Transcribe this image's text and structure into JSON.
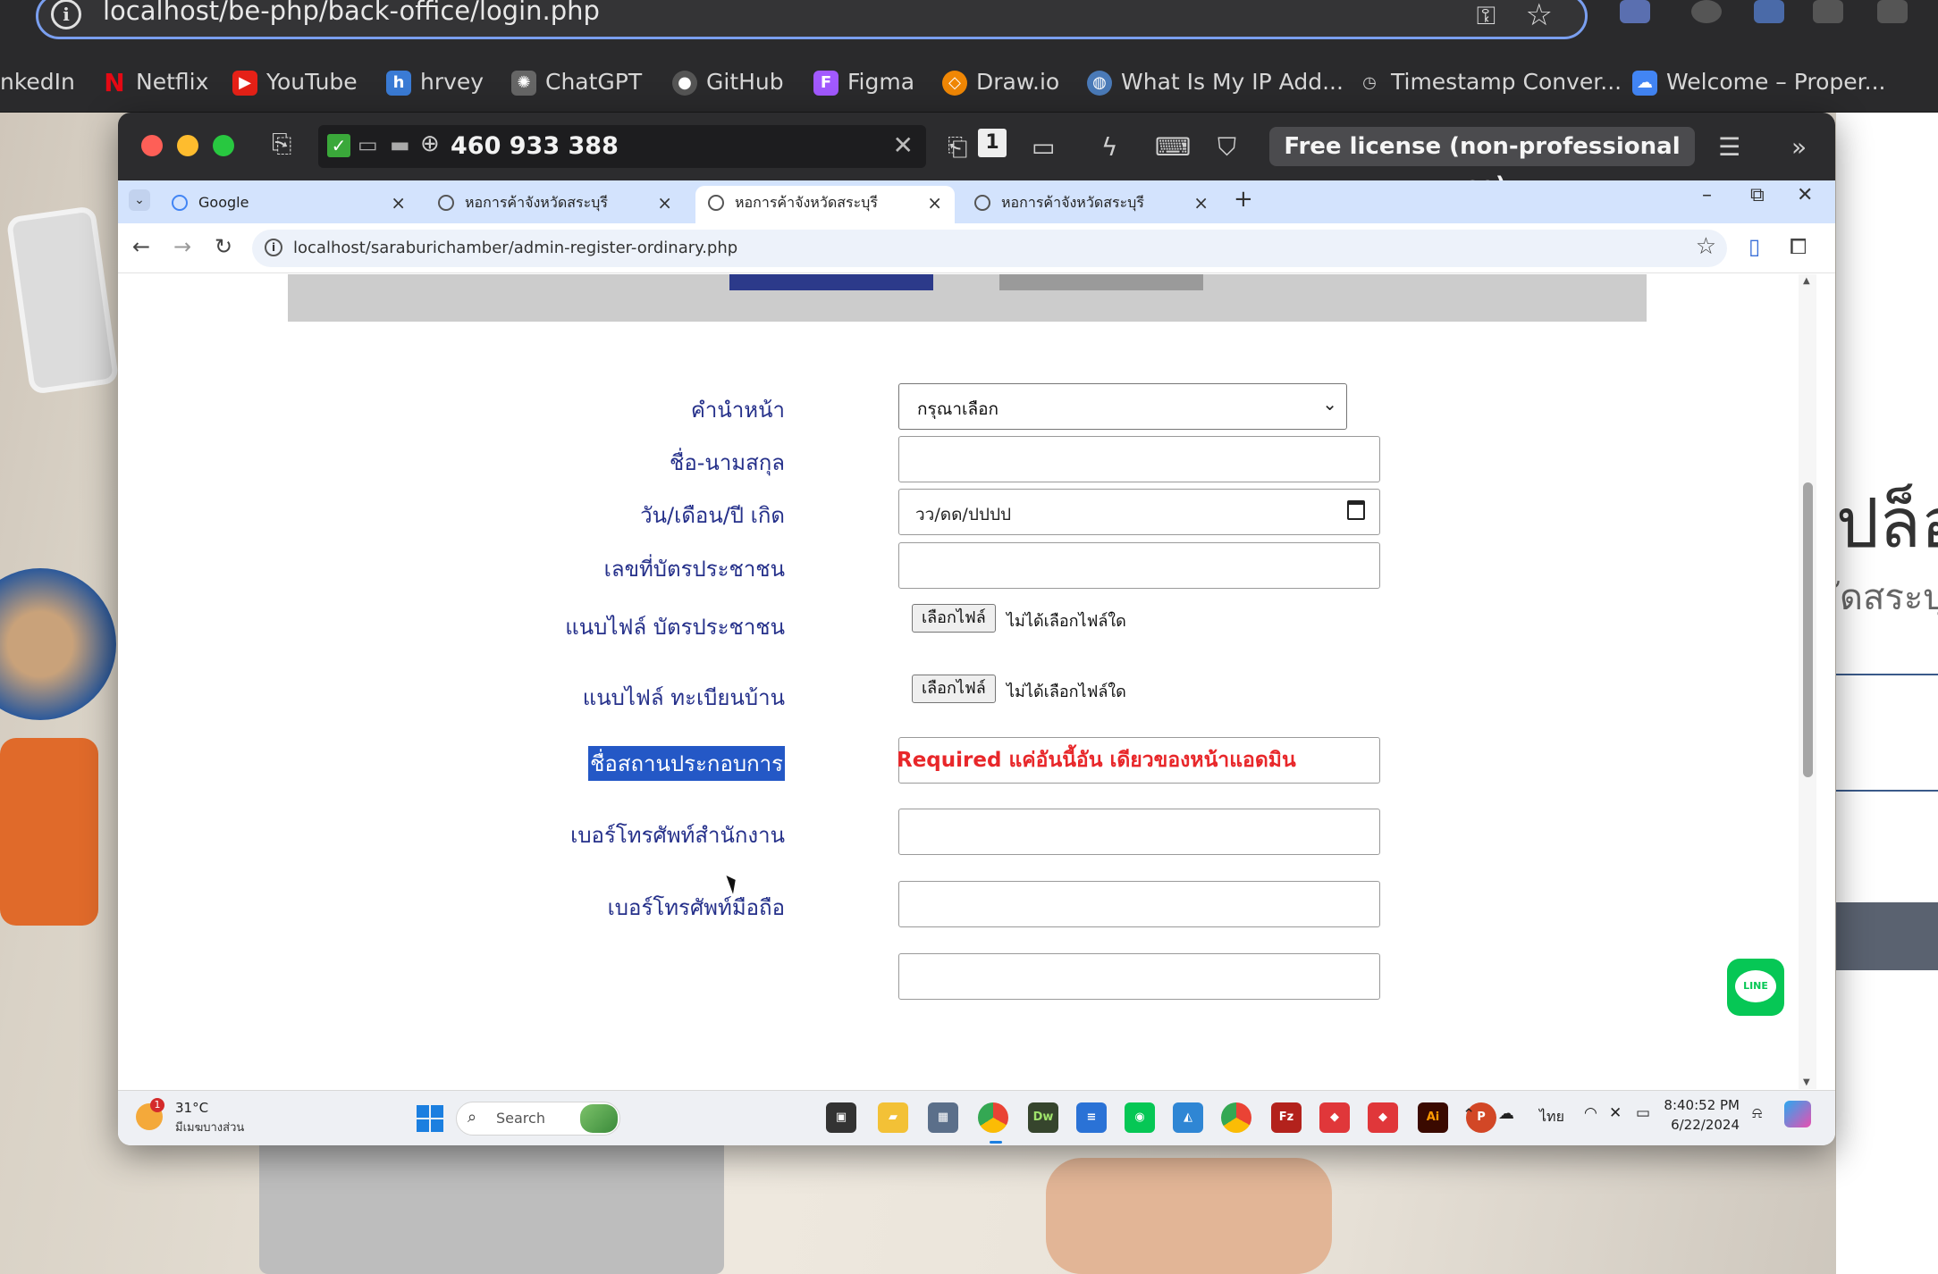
{
  "mac_browser": {
    "url": "localhost/be-php/back-office/login.php",
    "bookmarks": [
      "nkedIn",
      "Netflix",
      "YouTube",
      "hrvey",
      "ChatGPT",
      "GitHub",
      "Figma",
      "Draw.io",
      "What Is My IP Add...",
      "Timestamp Conver...",
      "Welcome – Proper..."
    ]
  },
  "anydesk": {
    "session_id": "460 933 388",
    "license_text": "Free license (non-professional use)."
  },
  "remote_browser": {
    "tabs": [
      {
        "label": "Google"
      },
      {
        "label": "หอการค้าจังหวัดสระบุรี"
      },
      {
        "label": "หอการค้าจังหวัดสระบุรี"
      },
      {
        "label": "หอการค้าจังหวัดสระบุรี"
      }
    ],
    "active_tab_index": 2,
    "url": "localhost/saraburichamber/admin-register-ordinary.php"
  },
  "form": {
    "title_label": "คำนำหน้า",
    "title_select_value": "กรุณาเลือก",
    "name_label": "ชื่อ-นามสกุล",
    "dob_label": "วัน/เดือน/ปี เกิด",
    "dob_placeholder": "วว/ดด/ปปปป",
    "id_label": "เลขที่บัตรประชาชน",
    "id_file_label": "แนบไฟล์ บัตรประชาชน",
    "house_file_label": "แนบไฟล์ ทะเบียนบ้าน",
    "choose_file_button": "เลือกไฟล์",
    "no_file_text": "ไม่ได้เลือกไฟล์ใด",
    "business_label": "ชื่อสถานประกอบการ",
    "business_annotation": "Required แค่อันนี้อัน เดียวของหน้าแอดมิน",
    "office_phone_label": "เบอร์โทรศัพท์สำนักงาน",
    "mobile_label": "เบอร์โทรศัพท์มือถือ"
  },
  "line_button_label": "LINE",
  "right_page": {
    "big_text": "ปล็อ",
    "sub_text": "ัดสระบุ"
  },
  "taskbar": {
    "temp": "31°C",
    "weather_desc": "มีเมฆบางส่วน",
    "weather_badge": "1",
    "search_label": "Search",
    "lang": "ไทย",
    "time": "8:40:52 PM",
    "date": "6/22/2024"
  },
  "colors": {
    "label_blue": "#25308a",
    "required_red": "#e8272a",
    "selection_blue": "#2458c6",
    "hero_gray": "#cccccc"
  }
}
